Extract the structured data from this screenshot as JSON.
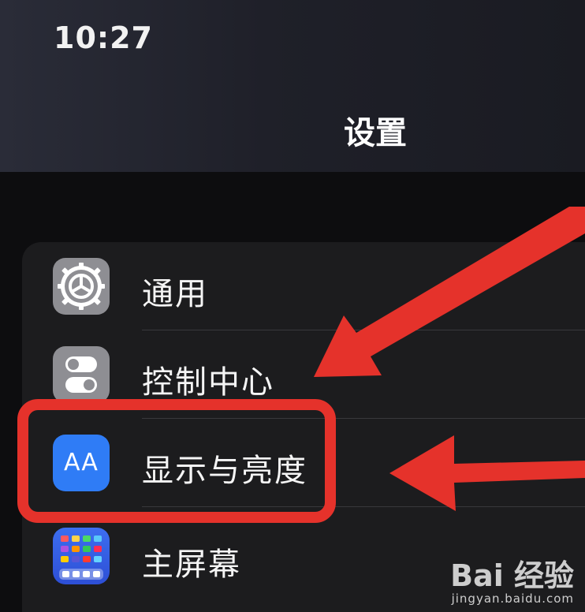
{
  "status_bar": {
    "time": "10:27"
  },
  "nav": {
    "title": "设置"
  },
  "settings_items": [
    {
      "label": "通用",
      "icon": "gear-icon",
      "color": "#8e8e93"
    },
    {
      "label": "控制中心",
      "icon": "toggle-switches-icon",
      "color": "#8e8e93"
    },
    {
      "label": "显示与亮度",
      "icon": "text-size-aa-icon",
      "icon_text": "AA",
      "color": "#2f7cf6"
    },
    {
      "label": "主屏幕",
      "icon": "app-grid-icon",
      "color": "#3d6ef0"
    }
  ],
  "annotations": {
    "highlight_color": "#e5322b"
  },
  "watermark": {
    "logo": "Bai 经验",
    "url": "jingyan.baidu.com"
  }
}
